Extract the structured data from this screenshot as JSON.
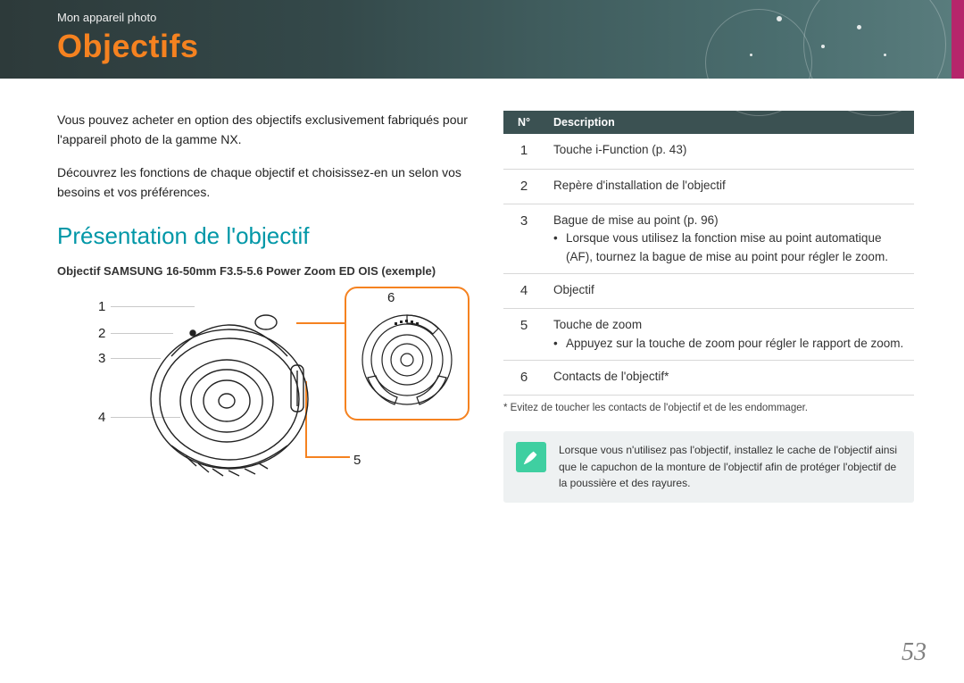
{
  "header": {
    "breadcrumb": "Mon appareil photo",
    "title": "Objectifs"
  },
  "intro": {
    "p1": "Vous pouvez acheter en option des objectifs exclusivement fabriqués pour l'appareil photo de la gamme NX.",
    "p2": "Découvrez les fonctions de chaque objectif et choisissez-en un selon vos besoins et vos préférences."
  },
  "section_title": "Présentation de l'objectif",
  "example_label": "Objectif SAMSUNG 16-50mm F3.5-5.6 Power Zoom ED OIS (exemple)",
  "diagram_labels": {
    "n1": "1",
    "n2": "2",
    "n3": "3",
    "n4": "4",
    "n5": "5",
    "n6": "6"
  },
  "table": {
    "head_num": "N°",
    "head_desc": "Description",
    "rows": [
      {
        "num": "1",
        "lines": [
          "Touche i-Function (p. 43)"
        ]
      },
      {
        "num": "2",
        "lines": [
          "Repère d'installation de l'objectif"
        ]
      },
      {
        "num": "3",
        "lines": [
          "Bague de mise au point (p. 96)",
          "Lorsque vous utilisez la fonction mise au point automatique (AF), tournez la bague de mise au point pour régler le zoom."
        ]
      },
      {
        "num": "4",
        "lines": [
          "Objectif"
        ]
      },
      {
        "num": "5",
        "lines": [
          "Touche de zoom",
          "Appuyez sur la touche de zoom pour régler le rapport de zoom."
        ]
      },
      {
        "num": "6",
        "lines": [
          "Contacts de l'objectif*"
        ]
      }
    ]
  },
  "footnote": "* Evitez de toucher les contacts de l'objectif et de les endommager.",
  "tip": "Lorsque vous n'utilisez pas l'objectif, installez le cache de l'objectif ainsi que le capuchon de la monture de l'objectif afin de protéger l'objectif de la poussière et des rayures.",
  "page_number": "53"
}
